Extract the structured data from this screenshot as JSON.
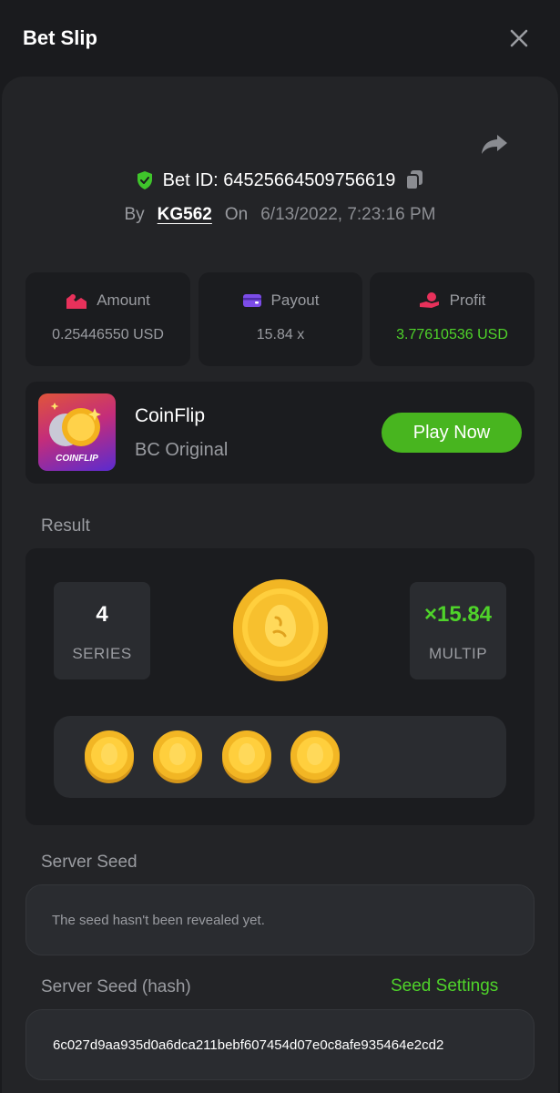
{
  "header": {
    "title": "Bet Slip"
  },
  "bet": {
    "id_text": "Bet ID: 64525664509756619",
    "by_label": "By",
    "user": "KG562",
    "on_label": "On",
    "date": "6/13/2022, 7:23:16 PM"
  },
  "stats": [
    {
      "label": "Amount",
      "value": "0.25446550 USD",
      "icon": "amount-icon",
      "icon_color": "#e8315b"
    },
    {
      "label": "Payout",
      "value": "15.84 x",
      "icon": "wallet-icon",
      "icon_color": "#7c4ce8"
    },
    {
      "label": "Profit",
      "value": "3.77610536 USD",
      "icon": "profit-icon",
      "icon_color": "#e8315b"
    }
  ],
  "game": {
    "name": "CoinFlip",
    "subtitle": "BC Original",
    "thumb_text": "COINFLIP",
    "play_label": "Play Now"
  },
  "result": {
    "section_label": "Result",
    "series_value": "4",
    "series_label": "SERIES",
    "multiplier_value": "×15.84",
    "multiplier_label": "MULTIP",
    "coin_count": 4
  },
  "server_seed": {
    "label": "Server Seed",
    "text": "The seed hasn't been revealed yet."
  },
  "server_seed_hash": {
    "label": "Server Seed (hash)",
    "settings_label": "Seed Settings",
    "value": "6c027d9aa935d0a6dca211bebf607454d07e0c8afe935464e2cd2"
  },
  "colors": {
    "accent_green": "#4fd32a",
    "play_button": "#48b51f",
    "background": "#1a1b1e",
    "panel": "#232427",
    "card": "#1b1c1f"
  }
}
